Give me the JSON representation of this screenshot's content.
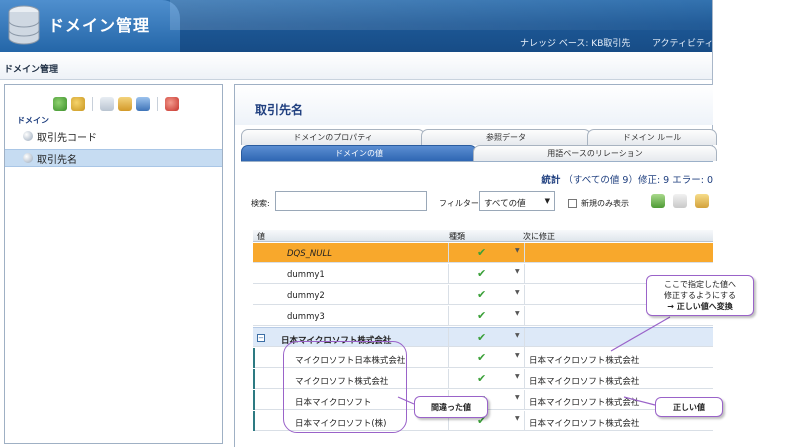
{
  "header": {
    "app_title": "ドメイン管理",
    "kb_status": "ナレッジ ベース: KB取引先",
    "activity": "アクティビティ:"
  },
  "breadcrumb": {
    "label": "ドメイン管理"
  },
  "left_panel": {
    "domain_label": "ドメイン",
    "toolbar_icons": [
      "create-domain-icon",
      "import-domain-icon",
      "copy-icon",
      "export-icon",
      "publish-icon",
      "delete-icon"
    ],
    "items": [
      {
        "label": "取引先コード",
        "selected": false
      },
      {
        "label": "取引先名",
        "selected": true
      }
    ]
  },
  "main": {
    "title": "取引先名",
    "tabs_row1": [
      "ドメインのプロパティ",
      "参照データ",
      "ドメイン ルール"
    ],
    "tabs_row2": [
      "ドメインの値",
      "用語ベースのリレーション"
    ],
    "active_tab": "ドメインの値",
    "stats": {
      "title": "統計",
      "detail": "（すべての値 9）修正: 9 エラー: 0"
    },
    "search": {
      "label": "検索:",
      "value": ""
    },
    "filter": {
      "label": "フィルター:",
      "value": "すべての値"
    },
    "new_only": {
      "label": "新規のみ表示",
      "checked": false
    },
    "grid": {
      "headers": [
        "値",
        "種類",
        "次に修正"
      ],
      "rows": [
        {
          "kind": "null",
          "value": "DQS_NULL",
          "correct_to": ""
        },
        {
          "kind": "normal",
          "value": "dummy1",
          "correct_to": ""
        },
        {
          "kind": "normal",
          "value": "dummy2",
          "correct_to": ""
        },
        {
          "kind": "normal",
          "value": "dummy3",
          "correct_to": ""
        },
        {
          "kind": "group",
          "value": "日本マイクロソフト株式会社",
          "correct_to": ""
        },
        {
          "kind": "child",
          "value": "マイクロソフト日本株式会社",
          "correct_to": "日本マイクロソフト株式会社"
        },
        {
          "kind": "child",
          "value": "マイクロソフト株式会社",
          "correct_to": "日本マイクロソフト株式会社"
        },
        {
          "kind": "child",
          "value": "日本マイクロソフト",
          "correct_to": "日本マイクロソフト株式会社"
        },
        {
          "kind": "child",
          "value": "日本マイクロソフト(株)",
          "correct_to": "日本マイクロソフト株式会社"
        }
      ]
    }
  },
  "callouts": {
    "top_line1": "ここで指定した値へ",
    "top_line2": "修正するようにする",
    "top_line3": "→ 正しい値へ変換",
    "wrong_values": "間違った値",
    "correct_value": "正しい値"
  },
  "colors": {
    "header_blue": "#1d5896",
    "null_row": "#f8a82c",
    "group_row": "#dde9f8",
    "callout_border": "#9a63c9",
    "check_green": "#3aa038"
  }
}
